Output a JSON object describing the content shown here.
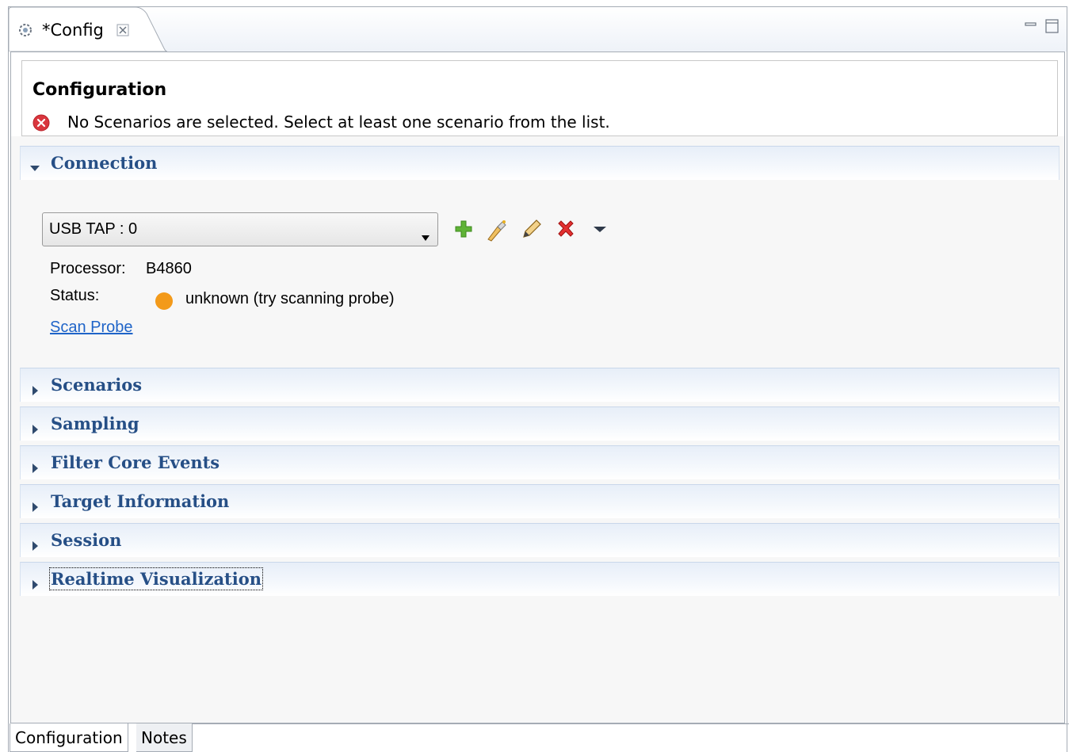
{
  "editor_tab": {
    "title": "*Config",
    "icon": "gear-config-icon",
    "close_icon": "close-icon"
  },
  "window_buttons": {
    "minimize_icon": "minimize-icon",
    "maximize_icon": "maximize-icon"
  },
  "header": {
    "title": "Configuration",
    "error_icon": "error-icon",
    "error_message": "No Scenarios are selected. Select at least one scenario from the list."
  },
  "connection": {
    "section_title": "Connection",
    "expanded": true,
    "probe_selected": "USB TAP : 0",
    "toolbar_icons": [
      "add-icon",
      "wizard-icon",
      "edit-icon",
      "delete-icon",
      "dropdown-menu-icon"
    ],
    "processor_label": "Processor:",
    "processor_value": "B4860",
    "status_label": "Status:",
    "status_value": "unknown (try scanning probe)",
    "status_color": "#f39a1a",
    "scan_link": "Scan Probe"
  },
  "sections": [
    {
      "title": "Scenarios",
      "expanded": false
    },
    {
      "title": "Sampling",
      "expanded": false
    },
    {
      "title": "Filter Core Events",
      "expanded": false
    },
    {
      "title": "Target Information",
      "expanded": false
    },
    {
      "title": "Session",
      "expanded": false
    },
    {
      "title": "Realtime Visualization",
      "expanded": false,
      "focused": true
    }
  ],
  "bottom_tabs": [
    {
      "label": "Configuration",
      "active": true
    },
    {
      "label": "Notes",
      "active": false
    }
  ],
  "colors": {
    "section_title": "#264f86",
    "link": "#1f64c8",
    "error": "#d9363e"
  }
}
